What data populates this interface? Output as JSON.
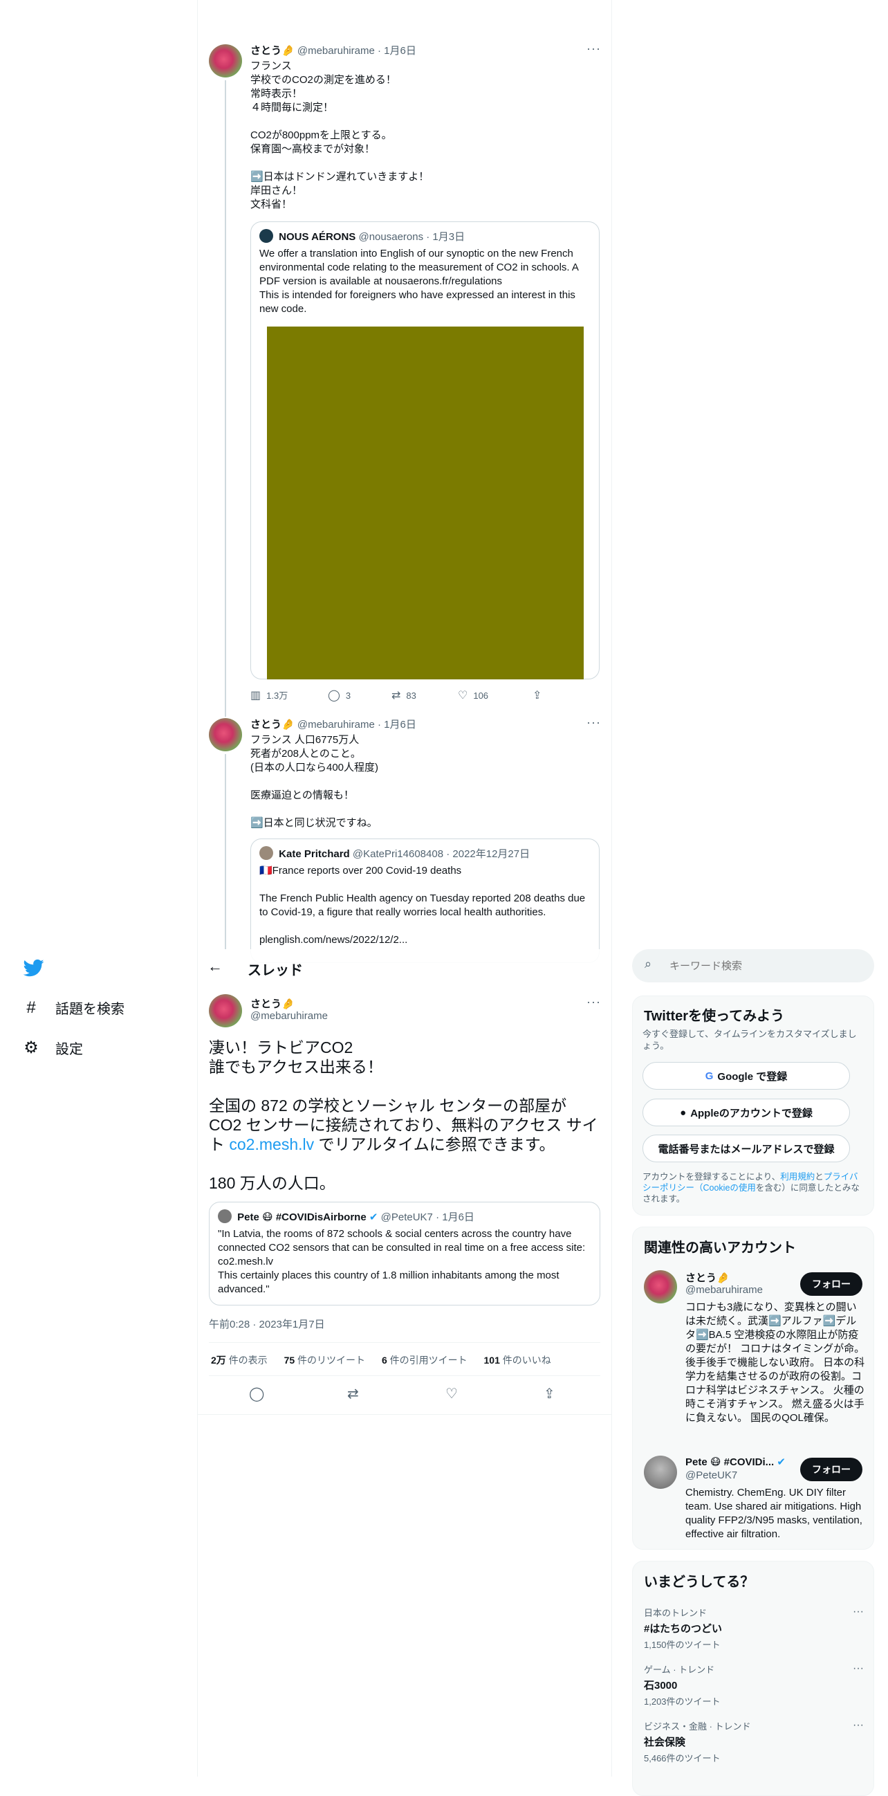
{
  "thread_top": {
    "tweet1": {
      "name": "さとう🤌",
      "handle": "@mebaruhirame",
      "date": "· 1月6日",
      "text": "フランス\n学校でのCO2の測定を進める！\n常時表示！\n４時間毎に測定！\n\nCO2が800ppmを上限とする。\n保育園〜高校までが対象！\n\n➡️日本はドンドン遅れていきますよ！\n岸田さん！\n文科省！",
      "quote": {
        "name": "NOUS AÉRONS",
        "handle": "@nousaerons",
        "date": "· 1月3日",
        "text": "We offer a translation into English of our synoptic on the new French environmental code relating to the measurement of CO2 in schools. A PDF version is available at nousaerons.fr/regulations\nThis is intended for foreigners who have expressed an interest in this new code.",
        "image_color": "#7b7b00"
      },
      "stats": {
        "views": "1.3万",
        "replies": "3",
        "retweets": "83",
        "likes": "106"
      }
    },
    "tweet2": {
      "name": "さとう🤌",
      "handle": "@mebaruhirame",
      "date": "· 1月6日",
      "text": "フランス 人口6775万人\n死者が208人とのこと。\n(日本の人口なら400人程度)\n\n医療逼迫との情報も！\n\n➡️日本と同じ状況ですね。",
      "quote": {
        "name": "Kate Pritchard",
        "handle": "@KatePri14608408",
        "date": "· 2022年12月27日",
        "text": "🇫🇷France reports over 200 Covid-19 deaths\n\nThe French Public Health agency on Tuesday reported 208 deaths due to Covid-19, a figure that really worries local health authorities.\n\nplenglish.com/news/2022/12/2..."
      }
    }
  },
  "nav": {
    "explore": "話題を検索",
    "settings": "設定"
  },
  "header": {
    "title": "スレッド"
  },
  "main_tweet": {
    "name": "さとう🤌",
    "handle": "@mebaruhirame",
    "text_a": "凄い！ラトビアCO2\n誰でもアクセス出来る！\n\n全国の 872 の学校とソーシャル センターの部屋が CO2 センサーに接続されており、無料のアクセス サイト ",
    "link": "co2.mesh.lv",
    "text_b": " でリアルタイムに参照できます。\n\n180 万人の人口。",
    "quote": {
      "name": "Pete 😷 #COVIDisAirborne",
      "handle": "@PeteUK7",
      "date": "· 1月6日",
      "text": "\"In Latvia, the rooms of 872 schools & social centers across the country have connected CO2 sensors that can be consulted in real time on a free access site: co2.mesh.lv\nThis certainly places this country of 1.8 million inhabitants among the most advanced.\""
    },
    "timestamp": "午前0:28 · 2023年1月7日",
    "stats": [
      {
        "value": "2万",
        "label": "件の表示"
      },
      {
        "value": "75",
        "label": "件のリツイート"
      },
      {
        "value": "6",
        "label": "件の引用ツイート"
      },
      {
        "value": "101",
        "label": "件のいいね"
      }
    ]
  },
  "search": {
    "placeholder": "キーワード検索"
  },
  "signup": {
    "title": "Twitterを使ってみよう",
    "subtitle": "今すぐ登録して、タイムラインをカスタマイズしましょう。",
    "google": "Google で登録",
    "apple": "Appleのアカウントで登録",
    "phone": "電話番号またはメールアドレスで登録",
    "legal_a": "アカウントを登録することにより、",
    "legal_terms": "利用規約",
    "legal_and": "と",
    "legal_privacy": "プライバシーポリシー（Cookieの使用",
    "legal_b": "を含む）に同意したとみなされます。"
  },
  "related": {
    "title": "関連性の高いアカウント",
    "accounts": [
      {
        "name": "さとう🤌",
        "handle": "@mebaruhirame",
        "follow": "フォロー",
        "bio": "コロナも3歳になり、変異株との闘いは未だ続く。武漢➡️アルファ➡️デルタ➡️BA.5 空港検疫の水際阻止が防疫の要だが！ コロナはタイミングが命。 後手後手で機能しない政府。 日本の科学力を結集させるのが政府の役割。コロナ科学はビジネスチャンス。 火種の時こそ消すチャンス。 燃え盛る火は手に負えない。 国民のQOL確保。"
      },
      {
        "name": "Pete 😷 #COVIDi...",
        "handle": "@PeteUK7",
        "follow": "フォロー",
        "bio": "Chemistry. ChemEng. UK DIY filter team. Use shared air mitigations. High quality FFP2/3/N95 masks, ventilation, effective air filtration."
      }
    ]
  },
  "trends": {
    "title": "いまどうしてる？",
    "items": [
      {
        "category": "日本のトレンド",
        "title": "#はたちのつどい",
        "count": "1,150件のツイート"
      },
      {
        "category": "ゲーム · トレンド",
        "title": "石3000",
        "count": "1,203件のツイート"
      },
      {
        "category": "ビジネス・金融 · トレンド",
        "title": "社会保険",
        "count": "5,466件のツイート"
      }
    ]
  },
  "colors": {
    "accent": "#1d9bf0",
    "text": "#0f1419",
    "muted": "#536471",
    "border": "#cfd9de"
  }
}
